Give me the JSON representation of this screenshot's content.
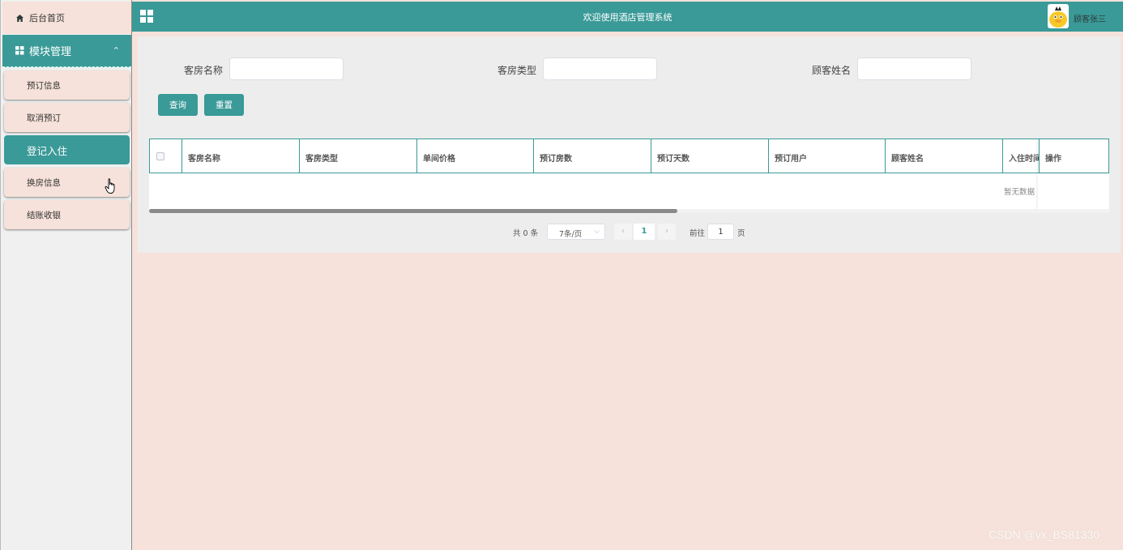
{
  "sidebar": {
    "home_label": "后台首页",
    "module_label": "模块管理",
    "items": [
      {
        "label": "预订信息",
        "active": false
      },
      {
        "label": "取消预订",
        "active": false
      },
      {
        "label": "登记入住",
        "active": true
      },
      {
        "label": "换房信息",
        "active": false
      },
      {
        "label": "结账收银",
        "active": false
      }
    ]
  },
  "header": {
    "title": "欢迎使用酒店管理系统",
    "username": "顾客张三"
  },
  "search": {
    "room_name_label": "客房名称",
    "room_name_value": "",
    "room_type_label": "客房类型",
    "room_type_value": "",
    "customer_name_label": "顾客姓名",
    "customer_name_value": "",
    "query_button": "查询",
    "reset_button": "重置"
  },
  "table": {
    "columns": [
      "客房名称",
      "客房类型",
      "单间价格",
      "预订房数",
      "预订天数",
      "预订用户",
      "顾客姓名",
      "入住时间",
      "操作"
    ],
    "rows": [],
    "empty_text": "暂无数据"
  },
  "pagination": {
    "total_text": "共 0 条",
    "page_size": "7条/页",
    "prev_icon": "‹",
    "next_icon": "›",
    "current_page": "1",
    "goto_label": "前往",
    "goto_value": "1",
    "page_suffix": "页"
  },
  "watermark": "CSDN @vx_BS81330",
  "colors": {
    "accent": "#3a9a98",
    "background": "#f6e2da",
    "panel": "#ededed"
  }
}
